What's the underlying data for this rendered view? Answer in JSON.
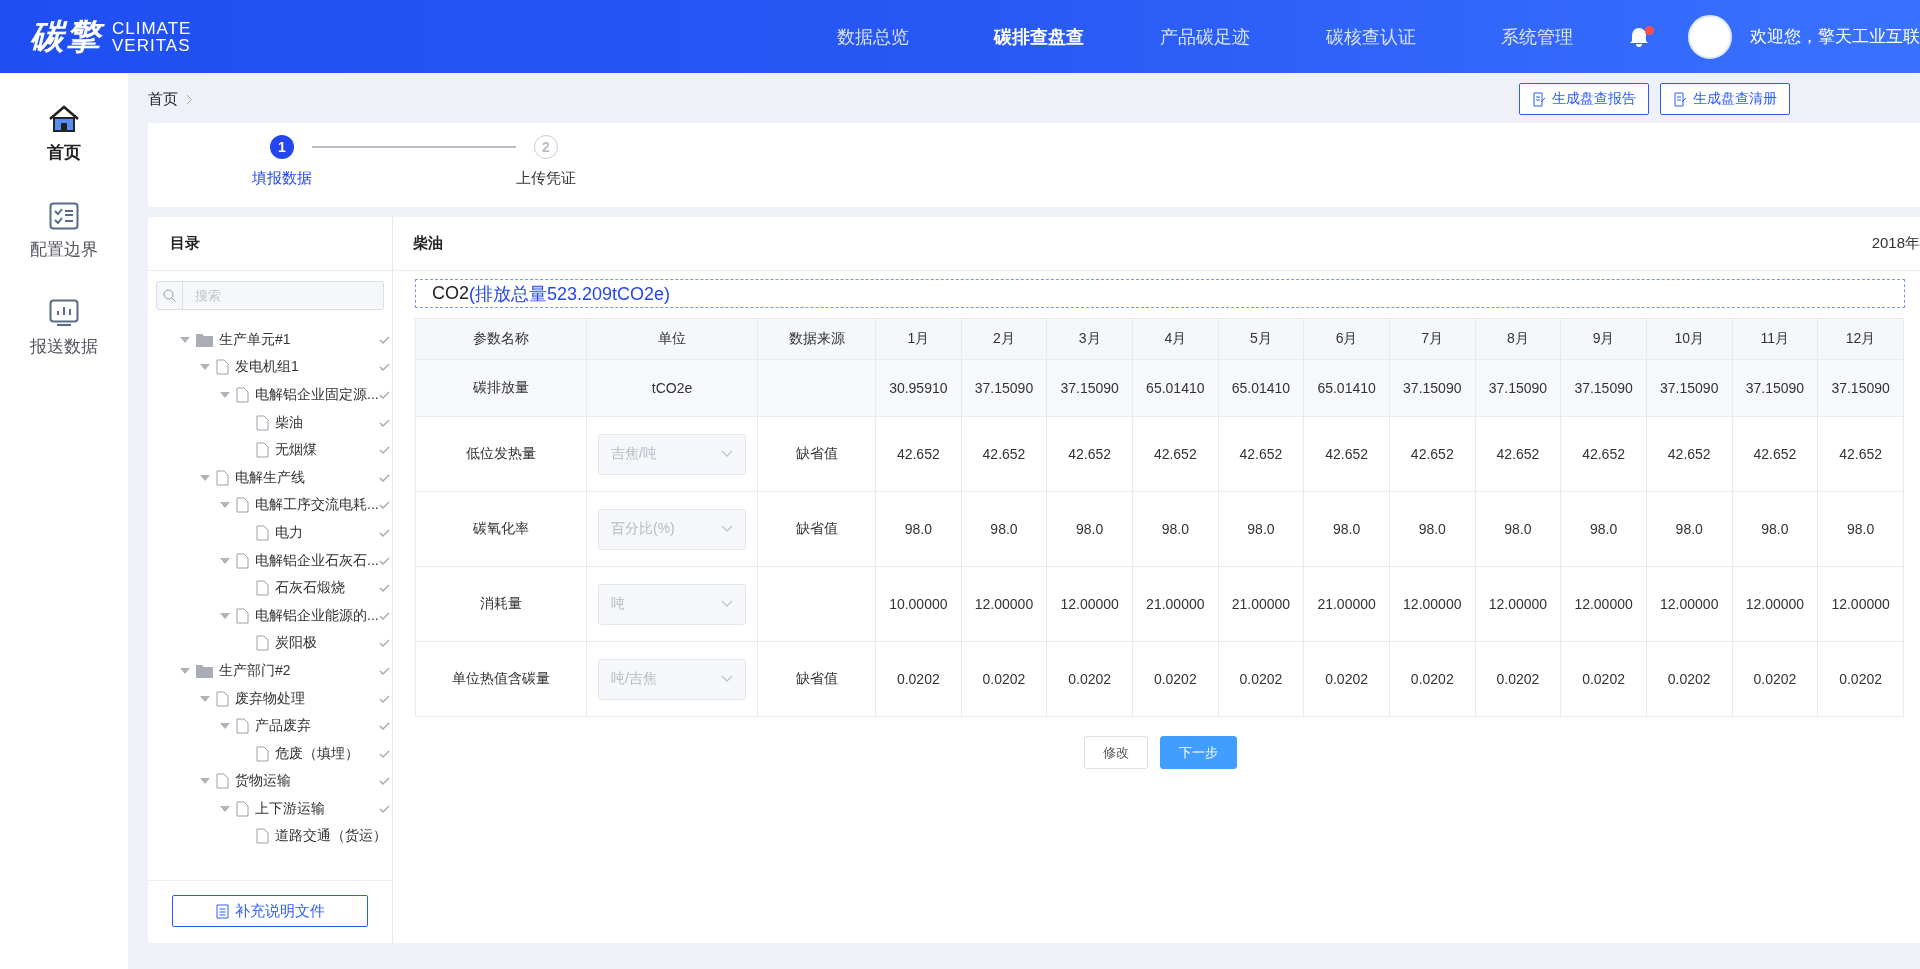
{
  "header": {
    "logo": {
      "mark": "碳擎",
      "line_1": "CLIMATE",
      "line_2": "VERITAS"
    },
    "nav": [
      {
        "label": "数据总览",
        "selected": false
      },
      {
        "label": "碳排查盘查",
        "selected": true
      },
      {
        "label": "产品碳足迹",
        "selected": false
      },
      {
        "label": "碳核查认证",
        "selected": false
      },
      {
        "label": "系统管理",
        "selected": false
      }
    ],
    "notification_dot": true,
    "welcome": "欢迎您，擎天工业互联"
  },
  "sidebar": {
    "items": [
      {
        "label": "首页",
        "kind": "home",
        "selected": true
      },
      {
        "label": "配置边界",
        "kind": "checklist",
        "selected": false
      },
      {
        "label": "报送数据",
        "kind": "chart",
        "selected": false
      }
    ]
  },
  "breadcrumb": [
    "首页"
  ],
  "actions": [
    "生成盘查报告",
    "生成盘查清册"
  ],
  "steps": [
    {
      "number": "1",
      "label": "填报数据",
      "active": true
    },
    {
      "number": "2",
      "label": "上传凭证",
      "active": false
    }
  ],
  "catalog": {
    "title": "目录",
    "search": {
      "placeholder": "搜索"
    },
    "tree": [
      {
        "label": "生产单元#1",
        "kind": "folder",
        "expanded": true,
        "checked": true,
        "children": [
          {
            "label": "发电机组1",
            "kind": "file",
            "expanded": true,
            "checked": true,
            "children": [
              {
                "label": "电解铝企业固定源...",
                "kind": "file",
                "expanded": true,
                "checked": true,
                "children": [
                  {
                    "label": "柴油",
                    "kind": "file",
                    "checked": true
                  },
                  {
                    "label": "无烟煤",
                    "kind": "file",
                    "checked": true
                  }
                ]
              }
            ]
          },
          {
            "label": "电解生产线",
            "kind": "file",
            "expanded": true,
            "checked": true,
            "children": [
              {
                "label": "电解工序交流电耗...",
                "kind": "file",
                "expanded": true,
                "checked": true,
                "children": [
                  {
                    "label": "电力",
                    "kind": "file",
                    "checked": true
                  }
                ]
              },
              {
                "label": "电解铝企业石灰石...",
                "kind": "file",
                "expanded": true,
                "checked": true,
                "children": [
                  {
                    "label": "石灰石煅烧",
                    "kind": "file",
                    "checked": true
                  }
                ]
              },
              {
                "label": "电解铝企业能源的...",
                "kind": "file",
                "expanded": true,
                "checked": true,
                "children": [
                  {
                    "label": "炭阳极",
                    "kind": "file",
                    "checked": true
                  }
                ]
              }
            ]
          }
        ]
      },
      {
        "label": "生产部门#2",
        "kind": "folder",
        "expanded": true,
        "checked": true,
        "children": [
          {
            "label": "废弃物处理",
            "kind": "file",
            "expanded": true,
            "checked": true,
            "children": [
              {
                "label": "产品废弃",
                "kind": "file",
                "expanded": true,
                "checked": true,
                "children": [
                  {
                    "label": "危废（填埋）",
                    "kind": "file",
                    "checked": true
                  }
                ]
              }
            ]
          },
          {
            "label": "货物运输",
            "kind": "file",
            "expanded": true,
            "checked": true,
            "children": [
              {
                "label": "上下游运输",
                "kind": "file",
                "expanded": true,
                "checked": true,
                "children": [
                  {
                    "label": "道路交通（货运）",
                    "kind": "file",
                    "checked": false
                  }
                ]
              }
            ]
          }
        ]
      }
    ],
    "button": "补充说明文件"
  },
  "detail": {
    "title": "柴油",
    "year": "2018年",
    "gas": {
      "name": "CO2",
      "total": "(排放总量523.209tCO2e)"
    },
    "table": {
      "columns": [
        "参数名称",
        "单位",
        "数据来源",
        "1月",
        "2月",
        "3月",
        "4月",
        "5月",
        "6月",
        "7月",
        "8月",
        "9月",
        "10月",
        "11月",
        "12月"
      ],
      "rows": [
        {
          "name": "碳排放量",
          "unit": "tCO2e",
          "kind": "text",
          "values": [
            "30.95910",
            "37.15090",
            "37.15090",
            "65.01410",
            "65.01410",
            "65.01410",
            "37.15090",
            "37.15090",
            "37.15090",
            "37.15090",
            "37.15090",
            "37.15090"
          ]
        },
        {
          "name": "低位发热量",
          "unit": "吉焦/吨",
          "kind": "select",
          "source": "缺省值",
          "values": [
            "42.652",
            "42.652",
            "42.652",
            "42.652",
            "42.652",
            "42.652",
            "42.652",
            "42.652",
            "42.652",
            "42.652",
            "42.652",
            "42.652"
          ]
        },
        {
          "name": "碳氧化率",
          "unit": "百分比(%)",
          "kind": "select",
          "source": "缺省值",
          "values": [
            "98.0",
            "98.0",
            "98.0",
            "98.0",
            "98.0",
            "98.0",
            "98.0",
            "98.0",
            "98.0",
            "98.0",
            "98.0",
            "98.0"
          ]
        },
        {
          "name": "消耗量",
          "unit": "吨",
          "kind": "select",
          "values": [
            "10.00000",
            "12.00000",
            "12.00000",
            "21.00000",
            "21.00000",
            "21.00000",
            "12.00000",
            "12.00000",
            "12.00000",
            "12.00000",
            "12.00000",
            "12.00000"
          ]
        },
        {
          "name": "单位热值含碳量",
          "unit": "吨/吉焦",
          "kind": "select",
          "source": "缺省值",
          "values": [
            "0.0202",
            "0.0202",
            "0.0202",
            "0.0202",
            "0.0202",
            "0.0202",
            "0.0202",
            "0.0202",
            "0.0202",
            "0.0202",
            "0.0202",
            "0.0202"
          ]
        }
      ]
    },
    "buttons": [
      {
        "label": "修改",
        "kind": "plain"
      },
      {
        "label": "下一步",
        "kind": "primary"
      }
    ]
  }
}
